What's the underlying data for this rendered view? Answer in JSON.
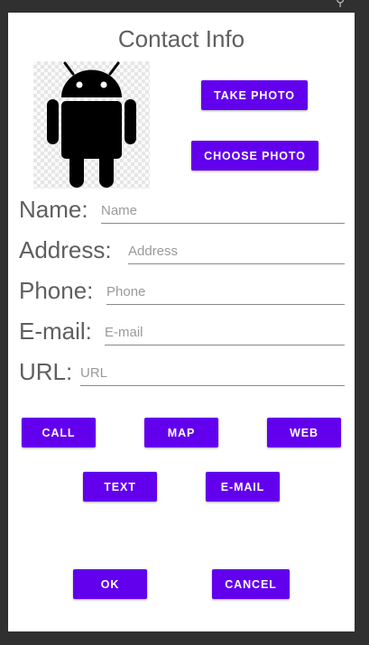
{
  "status_icon": "signal-icon",
  "title": "Contact Info",
  "photo": {
    "icon": "android-robot-icon",
    "robot_color": "#000000"
  },
  "buttons": {
    "take_photo": "TAKE PHOTO",
    "choose_photo": "CHOOSE PHOTO",
    "call": "CALL",
    "map": "MAP",
    "web": "WEB",
    "text": "TEXT",
    "email": "E-MAIL",
    "ok": "OK",
    "cancel": "CANCEL"
  },
  "fields": {
    "name": {
      "label": "Name:",
      "placeholder": "Name",
      "value": ""
    },
    "address": {
      "label": "Address:",
      "placeholder": "Address",
      "value": ""
    },
    "phone": {
      "label": "Phone:",
      "placeholder": "Phone",
      "value": ""
    },
    "email": {
      "label": "E-mail:",
      "placeholder": "E-mail",
      "value": ""
    },
    "url": {
      "label": "URL:",
      "placeholder": "URL",
      "value": ""
    }
  },
  "colors": {
    "accent": "#6200ee",
    "backdrop": "#303030",
    "dialog": "#ffffff",
    "label_text": "#5f5f5f"
  }
}
